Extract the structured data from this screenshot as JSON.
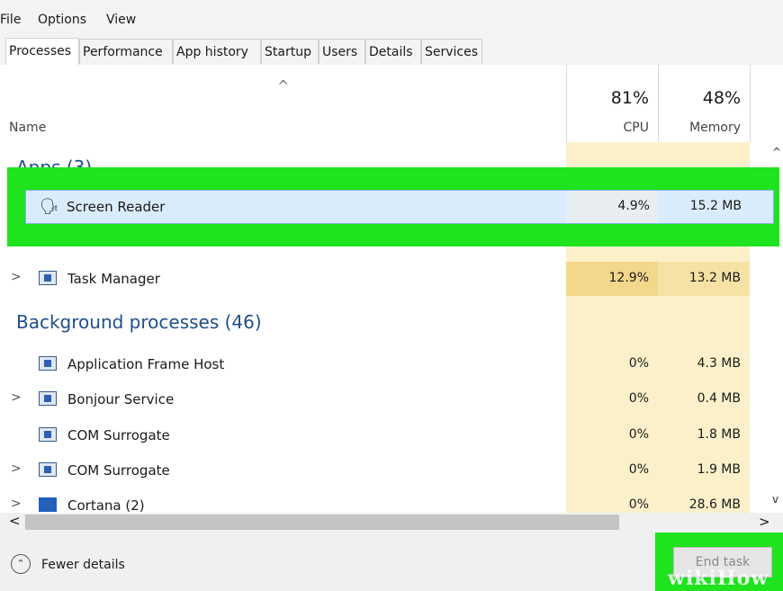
{
  "menu": {
    "file": "File",
    "options": "Options",
    "view": "View"
  },
  "tabs": [
    "Processes",
    "Performance",
    "App history",
    "Startup",
    "Users",
    "Details",
    "Services"
  ],
  "header": {
    "name": "Name",
    "cpu_pct": "81%",
    "cpu_label": "CPU",
    "mem_pct": "48%",
    "mem_label": "Memory"
  },
  "apps_group": "Apps (3)",
  "selected": {
    "name": "Screen Reader",
    "cpu": "4.9%",
    "mem": "15.2 MB"
  },
  "apps": [
    {
      "name": "Task Manager",
      "cpu": "12.9%",
      "mem": "13.2 MB"
    }
  ],
  "bg_group": "Background processes (46)",
  "bg": [
    {
      "name": "Application Frame Host",
      "cpu": "0%",
      "mem": "4.3 MB"
    },
    {
      "name": "Bonjour Service",
      "cpu": "0%",
      "mem": "0.4 MB"
    },
    {
      "name": "COM Surrogate",
      "cpu": "0%",
      "mem": "1.8 MB"
    },
    {
      "name": "COM Surrogate",
      "cpu": "0%",
      "mem": "1.9 MB"
    },
    {
      "name": "Cortana (2)",
      "cpu": "0%",
      "mem": "28.6 MB"
    }
  ],
  "footer": {
    "fewer": "Fewer details",
    "end_task": "End task"
  },
  "watermark": "wikiHow"
}
